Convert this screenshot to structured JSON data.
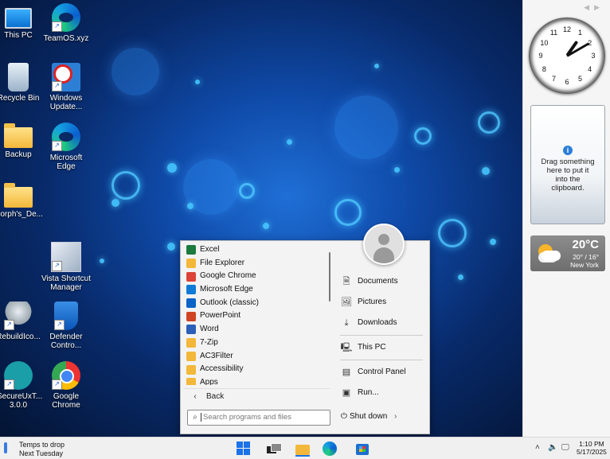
{
  "desktop": {
    "icons": [
      {
        "label": "This PC",
        "icon": "monitor-icon"
      },
      {
        "label": "TeamOS.xyz",
        "icon": "edge-icon"
      },
      {
        "label": "Recycle Bin",
        "icon": "recycle-bin-icon"
      },
      {
        "label": "Windows Update...",
        "icon": "windows-update-icon"
      },
      {
        "label": "Backup",
        "icon": "folder-icon"
      },
      {
        "label": "Microsoft Edge",
        "icon": "edge-icon"
      },
      {
        "label": "Morph's_De...",
        "icon": "folder-icon"
      },
      {
        "label": "Vista Shortcut Manager",
        "icon": "shortcut-manager-icon"
      },
      {
        "label": "RebuildIco...",
        "icon": "robot-icon"
      },
      {
        "label": "Defender Contro...",
        "icon": "shield-icon"
      },
      {
        "label": "SecureUxT... 3.0.0",
        "icon": "scalpel-icon"
      },
      {
        "label": "Google Chrome",
        "icon": "chrome-icon"
      }
    ]
  },
  "sidebar": {
    "clock": {
      "numbers": [
        "12",
        "1",
        "2",
        "3",
        "4",
        "5",
        "6",
        "7",
        "8",
        "9",
        "10",
        "11"
      ],
      "hour": 1,
      "minute": 10
    },
    "clipboard": {
      "text": "Drag something here to put it into the clipboard."
    },
    "weather": {
      "temp": "20°C",
      "range": "20° / 16°",
      "city": "New York"
    }
  },
  "start_menu": {
    "programs": [
      {
        "label": "Excel",
        "color": "#1d7a3d"
      },
      {
        "label": "File Explorer",
        "color": "#f3b73a"
      },
      {
        "label": "Google Chrome",
        "color": "#db4437"
      },
      {
        "label": "Microsoft Edge",
        "color": "#0f7bd6"
      },
      {
        "label": "Outlook (classic)",
        "color": "#0a64c8"
      },
      {
        "label": "PowerPoint",
        "color": "#d04423"
      },
      {
        "label": "Word",
        "color": "#2b5fb8"
      },
      {
        "label": "7-Zip",
        "color": "#f3b73a"
      },
      {
        "label": "AC3Filter",
        "color": "#f3b73a"
      },
      {
        "label": "Accessibility",
        "color": "#f3b73a"
      },
      {
        "label": "Apps",
        "color": "#f3b73a"
      }
    ],
    "back_label": "Back",
    "places": [
      {
        "label": "Documents",
        "icon": "document-icon"
      },
      {
        "label": "Pictures",
        "icon": "picture-icon"
      },
      {
        "label": "Downloads",
        "icon": "download-icon"
      },
      {
        "label": "This PC",
        "icon": "computer-icon"
      },
      {
        "label": "Control Panel",
        "icon": "control-panel-icon"
      },
      {
        "label": "Run...",
        "icon": "run-icon"
      }
    ],
    "search_placeholder": "Search programs and files",
    "shutdown_label": "Shut down"
  },
  "taskbar": {
    "weather_line1": "Temps to drop",
    "weather_line2": "Next Tuesday",
    "time": "1:10 PM",
    "date": "5/17/2025"
  }
}
